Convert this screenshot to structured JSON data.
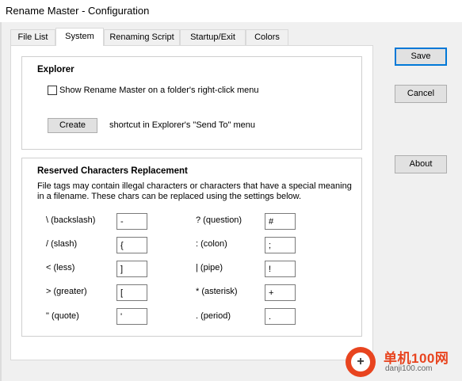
{
  "window": {
    "title": "Rename Master - Configuration"
  },
  "tabs": [
    {
      "label": "File List",
      "active": false
    },
    {
      "label": "System",
      "active": true
    },
    {
      "label": "Renaming Script",
      "active": false
    },
    {
      "label": "Startup/Exit",
      "active": false
    },
    {
      "label": "Colors",
      "active": false
    }
  ],
  "explorer": {
    "title": "Explorer",
    "checkbox_label": "Show Rename Master on a folder's right-click menu",
    "checked": false,
    "create_button": "Create",
    "create_desc": "shortcut in Explorer's \"Send To\" menu"
  },
  "reserved": {
    "title": "Reserved Characters Replacement",
    "desc_line1": "File tags may contain illegal characters or characters that have a special meaning",
    "desc_line2": "in a filename. These chars can be replaced using the settings below.",
    "left": [
      {
        "label": "\\ (backslash)",
        "value": "-"
      },
      {
        "label": "/ (slash)",
        "value": "{"
      },
      {
        "label": "< (less)",
        "value": "]"
      },
      {
        "label": "> (greater)",
        "value": "["
      },
      {
        "label": "\" (quote)",
        "value": "'"
      }
    ],
    "right": [
      {
        "label": "? (question)",
        "value": "#"
      },
      {
        "label": ": (colon)",
        "value": ";"
      },
      {
        "label": "| (pipe)",
        "value": "!"
      },
      {
        "label": "* (asterisk)",
        "value": "+"
      },
      {
        "label": ". (period)",
        "value": "."
      }
    ]
  },
  "buttons": {
    "save": "Save",
    "cancel": "Cancel",
    "about": "About"
  },
  "watermark": {
    "cn": "单机100网",
    "url": "danji100.com"
  },
  "colors": {
    "accent": "#0078d7",
    "watermark": "#e8441f"
  }
}
